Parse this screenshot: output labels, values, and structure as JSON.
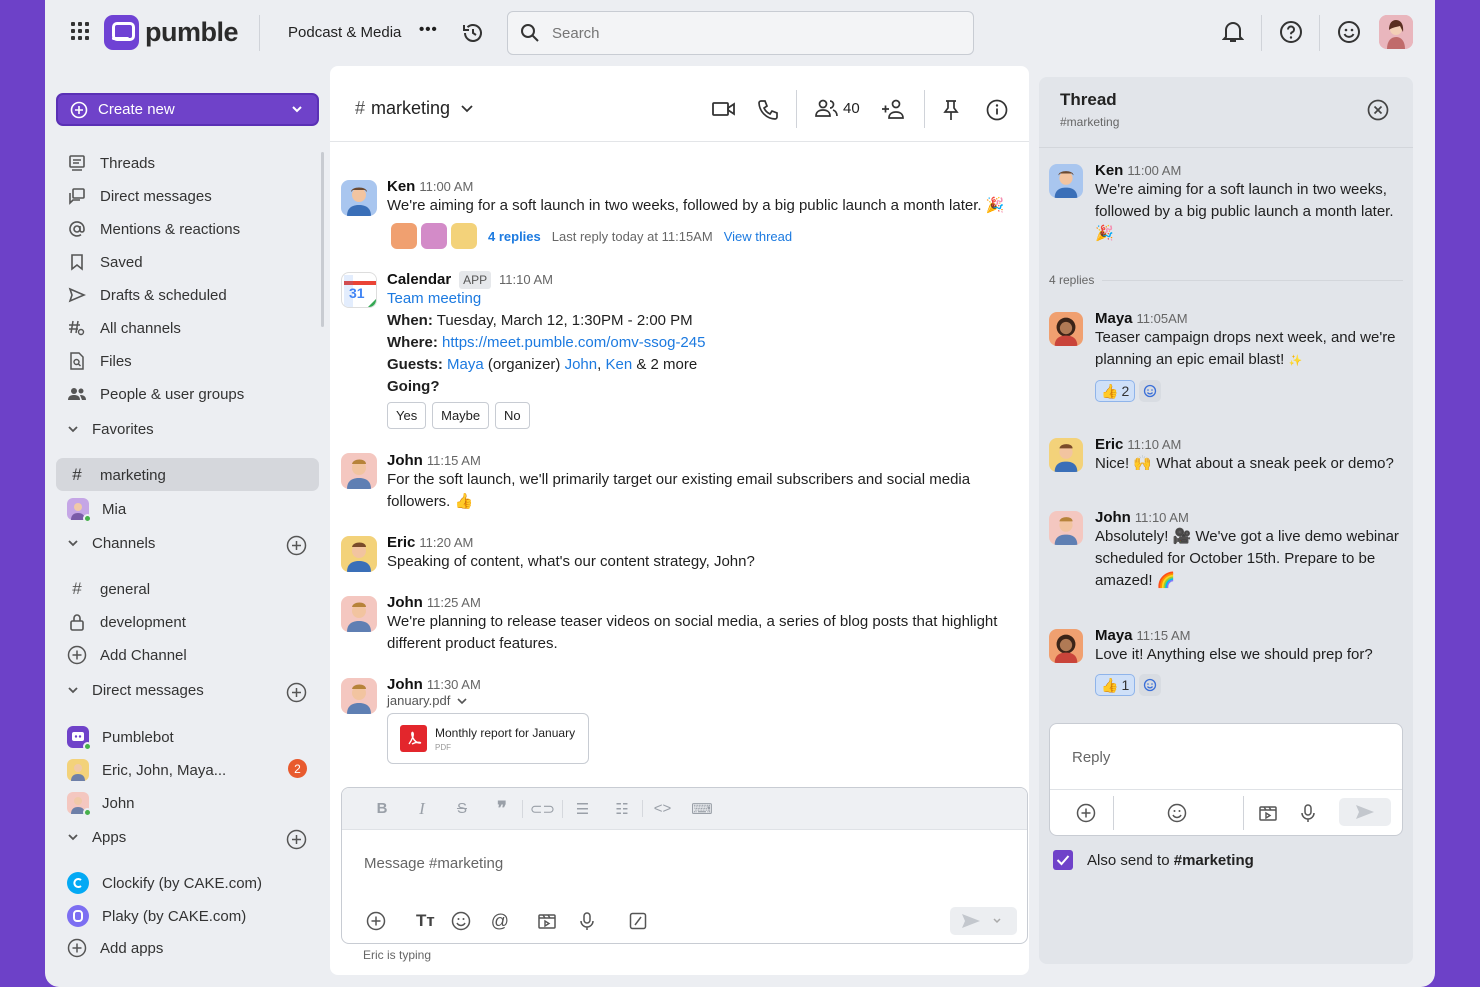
{
  "app": {
    "name": "pumble"
  },
  "topbar": {
    "workspace": "Podcast & Media",
    "search_placeholder": "Search"
  },
  "sidebar": {
    "create_new": "Create new",
    "nav": [
      {
        "label": "Threads"
      },
      {
        "label": "Direct messages"
      },
      {
        "label": "Mentions & reactions"
      },
      {
        "label": "Saved"
      },
      {
        "label": "Drafts & scheduled"
      },
      {
        "label": "All channels"
      },
      {
        "label": "Files"
      },
      {
        "label": "People & user groups"
      }
    ],
    "favorites_label": "Favorites",
    "favorites": [
      {
        "label": "marketing"
      },
      {
        "label": "Mia"
      }
    ],
    "channels_label": "Channels",
    "channels": [
      {
        "label": "general"
      },
      {
        "label": "development"
      }
    ],
    "add_channel": "Add Channel",
    "dms_label": "Direct messages",
    "dms": [
      {
        "label": "Pumblebot"
      },
      {
        "label": "Eric, John, Maya...",
        "badge": "2"
      },
      {
        "label": "John"
      }
    ],
    "apps_label": "Apps",
    "apps": [
      {
        "label": "Clockify (by CAKE.com)"
      },
      {
        "label": "Plaky (by CAKE.com)"
      }
    ],
    "add_apps": "Add apps"
  },
  "channel": {
    "name": "marketing",
    "members": "40",
    "messages": {
      "m1": {
        "user": "Ken",
        "time": "11:00 AM",
        "text": "We're aiming for a soft launch in two weeks, followed by a big public launch a month later.",
        "replies": "4 replies",
        "last_reply": "Last reply today at 11:15AM",
        "view_thread": "View thread"
      },
      "cal": {
        "user": "Calendar",
        "tag": "APP",
        "time": "11:10 AM",
        "event": "Team meeting",
        "when_label": "When:",
        "when": "Tuesday, March 12, 1:30PM - 2:00 PM",
        "where_label": "Where:",
        "where": "https://meet.pumble.com/omv-ssog-245",
        "guests_label": "Guests:",
        "guest1": "Maya",
        "organizer": "(organizer)",
        "guest2": "John",
        "sep": ",",
        "guest3": "Ken",
        "more": "& 2 more",
        "going": "Going?",
        "yes": "Yes",
        "maybe": "Maybe",
        "no": "No",
        "icon_day": "31"
      },
      "m2": {
        "user": "John",
        "time": "11:15 AM",
        "text": "For the soft launch, we'll primarily target our existing email subscribers and social media followers."
      },
      "m3": {
        "user": "Eric",
        "time": "11:20 AM",
        "text": "Speaking of content, what's our content strategy, John?"
      },
      "m4": {
        "user": "John",
        "time": "11:25 AM",
        "text": "We're planning to release teaser videos on social media, a series of blog posts that highlight different product features."
      },
      "m5": {
        "user": "John",
        "time": "11:30 AM",
        "file": "january.pdf",
        "file_title": "Monthly report for January",
        "file_type": "PDF"
      }
    },
    "composer_placeholder": "Message #marketing",
    "typing": "Eric is typing"
  },
  "thread": {
    "title": "Thread",
    "channel": "#marketing",
    "parent": {
      "user": "Ken",
      "time": "11:00 AM",
      "text": "We're aiming for a soft launch in two weeks, followed by a big public launch a month later."
    },
    "replies_count": "4 replies",
    "r1": {
      "user": "Maya",
      "time": "11:05AM",
      "text": "Teaser campaign drops next week, and we're planning an epic email blast!",
      "reaction_count": "2"
    },
    "r2": {
      "user": "Eric",
      "time": "11:10 AM",
      "text_a": "Nice!",
      "text_b": "What about a sneak peek or demo?"
    },
    "r3": {
      "user": "John",
      "time": "11:10 AM",
      "text_a": "Absolutely!",
      "text_b": "We've got a live demo webinar scheduled for October 15th. Prepare to be amazed!"
    },
    "r4": {
      "user": "Maya",
      "time": "11:15 AM",
      "text": "Love it! Anything else we should prep for?",
      "reaction_count": "1"
    },
    "reply_placeholder": "Reply",
    "also_send_prefix": "Also send to",
    "also_send_channel": "#marketing"
  },
  "colors": {
    "brand": "#6f42c9",
    "link": "#1c7ae0",
    "badge": "#e85a2e",
    "bg": "#6d41c8"
  }
}
